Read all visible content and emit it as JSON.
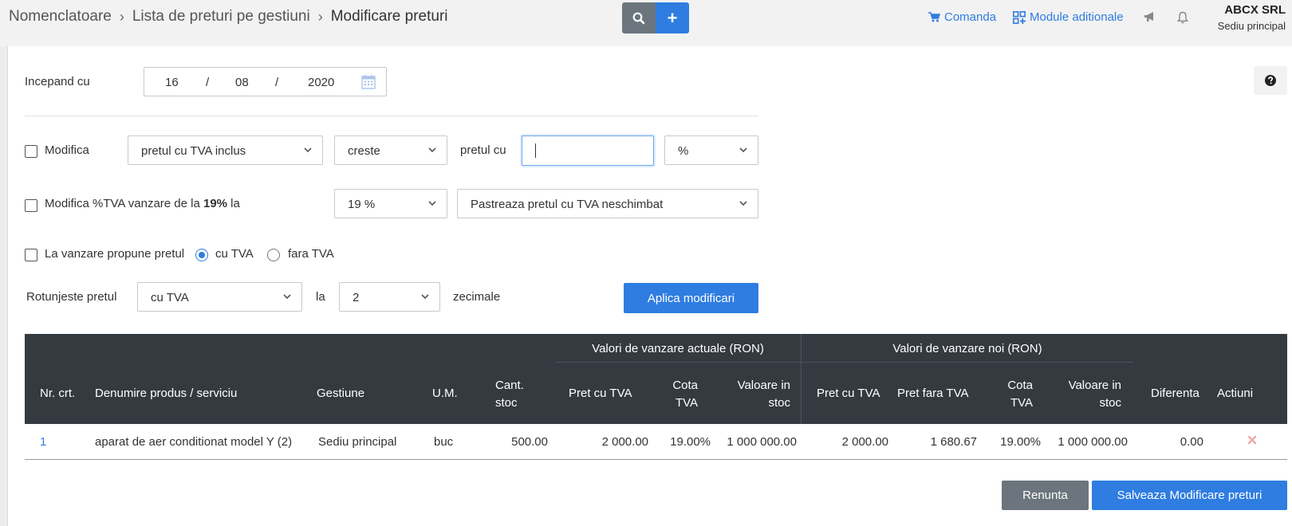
{
  "header": {
    "breadcrumb": [
      "Nomenclatoare",
      "Lista de preturi pe gestiuni",
      "Modificare preturi"
    ],
    "breadcrumb_sep": "›",
    "search_icon": "search-icon",
    "add_label": "+",
    "comanda_label": "Comanda",
    "module_label": "Module aditionale",
    "company_name": "ABCX SRL",
    "company_branch": "Sediu principal"
  },
  "form": {
    "start_label": "Incepand cu",
    "date": {
      "day": "16",
      "month": "08",
      "year": "2020",
      "sep": "/"
    },
    "help_icon": "question-circle-icon",
    "modifica_label": "Modifica",
    "price_type": "pretul cu TVA inclus",
    "direction": "creste",
    "pretul_cu_label": "pretul cu",
    "amount_value": "",
    "unit": "%",
    "tva_label_prefix": "Modifica %TVA vanzare de la ",
    "tva_label_bold": "19%",
    "tva_label_suffix": " la",
    "tva_select": "19 %",
    "tva_mode": "Pastreaza pretul cu TVA neschimbat",
    "propune_label": "La vanzare propune pretul",
    "radio_cu_tva": "cu TVA",
    "radio_fara_tva": "fara TVA",
    "rotunjeste_label": "Rotunjeste pretul",
    "rotunjeste_select": "cu TVA",
    "la_label": "la",
    "decimals_select": "2",
    "zecimale_label": "zecimale",
    "apply_button": "Aplica modificari"
  },
  "table": {
    "group_actual": "Valori de vanzare actuale (RON)",
    "group_new": "Valori de vanzare noi (RON)",
    "headers": {
      "nr": "Nr. crt.",
      "denumire": "Denumire produs / serviciu",
      "gestiune": "Gestiune",
      "um": "U.M.",
      "cant_1": "Cant.",
      "cant_2": "stoc",
      "pret_tva": "Pret cu TVA",
      "cota_1": "Cota",
      "cota_2": "TVA",
      "valoare_1": "Valoare in",
      "valoare_2": "stoc",
      "pret_tva_new": "Pret cu TVA",
      "pret_fara_new": "Pret fara TVA",
      "cota_new_1": "Cota",
      "cota_new_2": "TVA",
      "valoare_new_1": "Valoare in",
      "valoare_new_2": "stoc",
      "diferenta": "Diferenta",
      "actiuni": "Actiuni"
    },
    "rows": [
      {
        "nr": "1",
        "denumire": "aparat de aer conditionat model Y (2)",
        "gestiune": "Sediu principal",
        "um": "buc",
        "cant": "500.00",
        "pret_tva": "2 000.00",
        "cota": "19.00%",
        "valoare": "1 000 000.00",
        "pret_tva_new": "2 000.00",
        "pret_fara_new": "1 680.67",
        "cota_new": "19.00%",
        "valoare_new": "1 000 000.00",
        "diferenta": "0.00",
        "action_icon": "delete-x-icon"
      }
    ]
  },
  "footer": {
    "cancel_button": "Renunta",
    "save_button": "Salveaza Modificare preturi"
  },
  "colors": {
    "primary": "#2f7de1",
    "grey_button": "#6c757d",
    "table_header": "#343a40",
    "delete_icon": "#f2a7a7"
  }
}
